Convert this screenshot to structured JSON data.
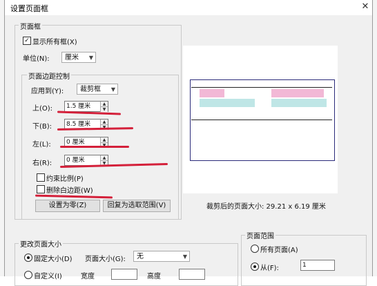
{
  "title": "设置页面框",
  "close_glyph": "✕",
  "pageframe": {
    "legend": "页面框",
    "show_all_label": "显示所有框(X)",
    "show_all_checked": true,
    "unit_label": "单位(N):",
    "unit_value": "厘米"
  },
  "margins": {
    "legend": "页面边距控制",
    "apply_label": "应用到(Y):",
    "apply_value": "裁剪框",
    "top_label": "上(O):",
    "top_value": "1.5 厘米",
    "bottom_label": "下(B):",
    "bottom_value": "8.5 厘米",
    "left_label": "左(L):",
    "left_value": "0 厘米",
    "right_label": "右(R):",
    "right_value": "0 厘米",
    "constrain_label": "约束比例(P)",
    "remove_white_label": "删除白边距(W)",
    "zero_button": "设置为零(Z)",
    "restore_button": "回复为选取范围(V)"
  },
  "preview": {
    "caption": "裁剪后的页面大小: 29.21 x 6.19 厘米"
  },
  "page_size": {
    "legend": "更改页面大小",
    "fixed_label": "固定大小(D)",
    "size_label": "页面大小(G):",
    "size_value": "无",
    "custom_label": "自定义(I)",
    "width_label": "宽度",
    "height_label": "高度"
  },
  "page_range": {
    "legend": "页面范围",
    "all_label": "所有页面(A)",
    "from_label": "从(F):",
    "from_value": "1"
  },
  "colors": {
    "annotation_red": "#d4203a",
    "crop_border": "#2a2a7a"
  }
}
